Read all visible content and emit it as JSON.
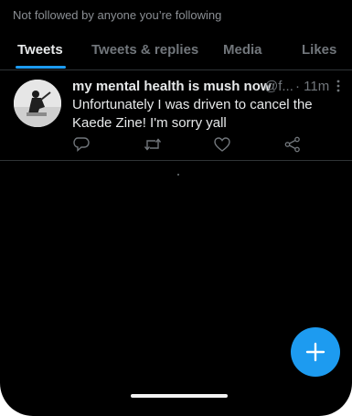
{
  "profile": {
    "follow_note": "Not followed by anyone you’re following"
  },
  "tabs": [
    {
      "label": "Tweets",
      "active": true
    },
    {
      "label": "Tweets & replies",
      "active": false
    },
    {
      "label": "Media",
      "active": false
    },
    {
      "label": "Likes",
      "active": false
    }
  ],
  "tweet": {
    "display_name": "my mental health is mush now",
    "handle": "@f...",
    "time": "· 11m",
    "text": "Unfortunately I was driven to cancel the Kaede Zine! I'm sorry yall",
    "actions": [
      "reply-icon",
      "retweet-icon",
      "like-icon",
      "share-icon"
    ]
  },
  "fab": {
    "icon": "compose-plus-icon"
  },
  "colors": {
    "background": "#000000",
    "accent": "#1d9bf0",
    "primary_text": "#e7e9ea",
    "secondary_text": "#71767b"
  }
}
